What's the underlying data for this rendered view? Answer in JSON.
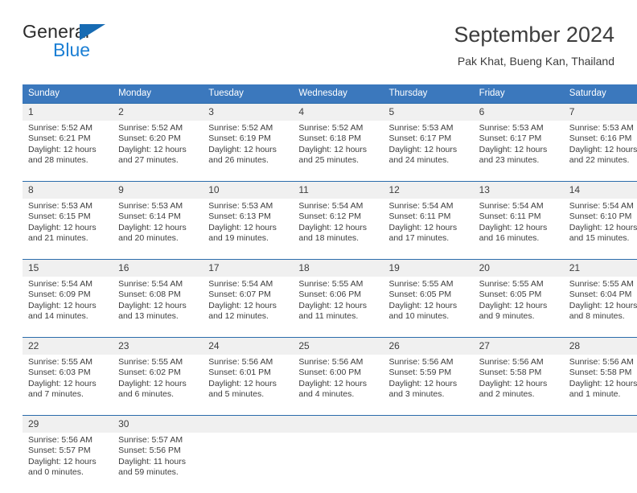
{
  "brand": {
    "line1": "General",
    "line2": "Blue",
    "accent_color": "#176bb3",
    "blue_color": "#1b7fd4"
  },
  "header": {
    "title": "September 2024",
    "subtitle": "Pak Khat, Bueng Kan, Thailand"
  },
  "theme": {
    "header_bg": "#3b78bd",
    "daynum_bg": "#f0f0f0",
    "row_border": "#2b6cab",
    "text": "#3d3d3d"
  },
  "weekdays": [
    "Sunday",
    "Monday",
    "Tuesday",
    "Wednesday",
    "Thursday",
    "Friday",
    "Saturday"
  ],
  "weeks": [
    [
      {
        "day": "1",
        "sunrise": "Sunrise: 5:52 AM",
        "sunset": "Sunset: 6:21 PM",
        "daylight1": "Daylight: 12 hours",
        "daylight2": "and 28 minutes."
      },
      {
        "day": "2",
        "sunrise": "Sunrise: 5:52 AM",
        "sunset": "Sunset: 6:20 PM",
        "daylight1": "Daylight: 12 hours",
        "daylight2": "and 27 minutes."
      },
      {
        "day": "3",
        "sunrise": "Sunrise: 5:52 AM",
        "sunset": "Sunset: 6:19 PM",
        "daylight1": "Daylight: 12 hours",
        "daylight2": "and 26 minutes."
      },
      {
        "day": "4",
        "sunrise": "Sunrise: 5:52 AM",
        "sunset": "Sunset: 6:18 PM",
        "daylight1": "Daylight: 12 hours",
        "daylight2": "and 25 minutes."
      },
      {
        "day": "5",
        "sunrise": "Sunrise: 5:53 AM",
        "sunset": "Sunset: 6:17 PM",
        "daylight1": "Daylight: 12 hours",
        "daylight2": "and 24 minutes."
      },
      {
        "day": "6",
        "sunrise": "Sunrise: 5:53 AM",
        "sunset": "Sunset: 6:17 PM",
        "daylight1": "Daylight: 12 hours",
        "daylight2": "and 23 minutes."
      },
      {
        "day": "7",
        "sunrise": "Sunrise: 5:53 AM",
        "sunset": "Sunset: 6:16 PM",
        "daylight1": "Daylight: 12 hours",
        "daylight2": "and 22 minutes."
      }
    ],
    [
      {
        "day": "8",
        "sunrise": "Sunrise: 5:53 AM",
        "sunset": "Sunset: 6:15 PM",
        "daylight1": "Daylight: 12 hours",
        "daylight2": "and 21 minutes."
      },
      {
        "day": "9",
        "sunrise": "Sunrise: 5:53 AM",
        "sunset": "Sunset: 6:14 PM",
        "daylight1": "Daylight: 12 hours",
        "daylight2": "and 20 minutes."
      },
      {
        "day": "10",
        "sunrise": "Sunrise: 5:53 AM",
        "sunset": "Sunset: 6:13 PM",
        "daylight1": "Daylight: 12 hours",
        "daylight2": "and 19 minutes."
      },
      {
        "day": "11",
        "sunrise": "Sunrise: 5:54 AM",
        "sunset": "Sunset: 6:12 PM",
        "daylight1": "Daylight: 12 hours",
        "daylight2": "and 18 minutes."
      },
      {
        "day": "12",
        "sunrise": "Sunrise: 5:54 AM",
        "sunset": "Sunset: 6:11 PM",
        "daylight1": "Daylight: 12 hours",
        "daylight2": "and 17 minutes."
      },
      {
        "day": "13",
        "sunrise": "Sunrise: 5:54 AM",
        "sunset": "Sunset: 6:11 PM",
        "daylight1": "Daylight: 12 hours",
        "daylight2": "and 16 minutes."
      },
      {
        "day": "14",
        "sunrise": "Sunrise: 5:54 AM",
        "sunset": "Sunset: 6:10 PM",
        "daylight1": "Daylight: 12 hours",
        "daylight2": "and 15 minutes."
      }
    ],
    [
      {
        "day": "15",
        "sunrise": "Sunrise: 5:54 AM",
        "sunset": "Sunset: 6:09 PM",
        "daylight1": "Daylight: 12 hours",
        "daylight2": "and 14 minutes."
      },
      {
        "day": "16",
        "sunrise": "Sunrise: 5:54 AM",
        "sunset": "Sunset: 6:08 PM",
        "daylight1": "Daylight: 12 hours",
        "daylight2": "and 13 minutes."
      },
      {
        "day": "17",
        "sunrise": "Sunrise: 5:54 AM",
        "sunset": "Sunset: 6:07 PM",
        "daylight1": "Daylight: 12 hours",
        "daylight2": "and 12 minutes."
      },
      {
        "day": "18",
        "sunrise": "Sunrise: 5:55 AM",
        "sunset": "Sunset: 6:06 PM",
        "daylight1": "Daylight: 12 hours",
        "daylight2": "and 11 minutes."
      },
      {
        "day": "19",
        "sunrise": "Sunrise: 5:55 AM",
        "sunset": "Sunset: 6:05 PM",
        "daylight1": "Daylight: 12 hours",
        "daylight2": "and 10 minutes."
      },
      {
        "day": "20",
        "sunrise": "Sunrise: 5:55 AM",
        "sunset": "Sunset: 6:05 PM",
        "daylight1": "Daylight: 12 hours",
        "daylight2": "and 9 minutes."
      },
      {
        "day": "21",
        "sunrise": "Sunrise: 5:55 AM",
        "sunset": "Sunset: 6:04 PM",
        "daylight1": "Daylight: 12 hours",
        "daylight2": "and 8 minutes."
      }
    ],
    [
      {
        "day": "22",
        "sunrise": "Sunrise: 5:55 AM",
        "sunset": "Sunset: 6:03 PM",
        "daylight1": "Daylight: 12 hours",
        "daylight2": "and 7 minutes."
      },
      {
        "day": "23",
        "sunrise": "Sunrise: 5:55 AM",
        "sunset": "Sunset: 6:02 PM",
        "daylight1": "Daylight: 12 hours",
        "daylight2": "and 6 minutes."
      },
      {
        "day": "24",
        "sunrise": "Sunrise: 5:56 AM",
        "sunset": "Sunset: 6:01 PM",
        "daylight1": "Daylight: 12 hours",
        "daylight2": "and 5 minutes."
      },
      {
        "day": "25",
        "sunrise": "Sunrise: 5:56 AM",
        "sunset": "Sunset: 6:00 PM",
        "daylight1": "Daylight: 12 hours",
        "daylight2": "and 4 minutes."
      },
      {
        "day": "26",
        "sunrise": "Sunrise: 5:56 AM",
        "sunset": "Sunset: 5:59 PM",
        "daylight1": "Daylight: 12 hours",
        "daylight2": "and 3 minutes."
      },
      {
        "day": "27",
        "sunrise": "Sunrise: 5:56 AM",
        "sunset": "Sunset: 5:58 PM",
        "daylight1": "Daylight: 12 hours",
        "daylight2": "and 2 minutes."
      },
      {
        "day": "28",
        "sunrise": "Sunrise: 5:56 AM",
        "sunset": "Sunset: 5:58 PM",
        "daylight1": "Daylight: 12 hours",
        "daylight2": "and 1 minute."
      }
    ],
    [
      {
        "day": "29",
        "sunrise": "Sunrise: 5:56 AM",
        "sunset": "Sunset: 5:57 PM",
        "daylight1": "Daylight: 12 hours",
        "daylight2": "and 0 minutes."
      },
      {
        "day": "30",
        "sunrise": "Sunrise: 5:57 AM",
        "sunset": "Sunset: 5:56 PM",
        "daylight1": "Daylight: 11 hours",
        "daylight2": "and 59 minutes."
      },
      {
        "day": "",
        "sunrise": "",
        "sunset": "",
        "daylight1": "",
        "daylight2": ""
      },
      {
        "day": "",
        "sunrise": "",
        "sunset": "",
        "daylight1": "",
        "daylight2": ""
      },
      {
        "day": "",
        "sunrise": "",
        "sunset": "",
        "daylight1": "",
        "daylight2": ""
      },
      {
        "day": "",
        "sunrise": "",
        "sunset": "",
        "daylight1": "",
        "daylight2": ""
      },
      {
        "day": "",
        "sunrise": "",
        "sunset": "",
        "daylight1": "",
        "daylight2": ""
      }
    ]
  ]
}
